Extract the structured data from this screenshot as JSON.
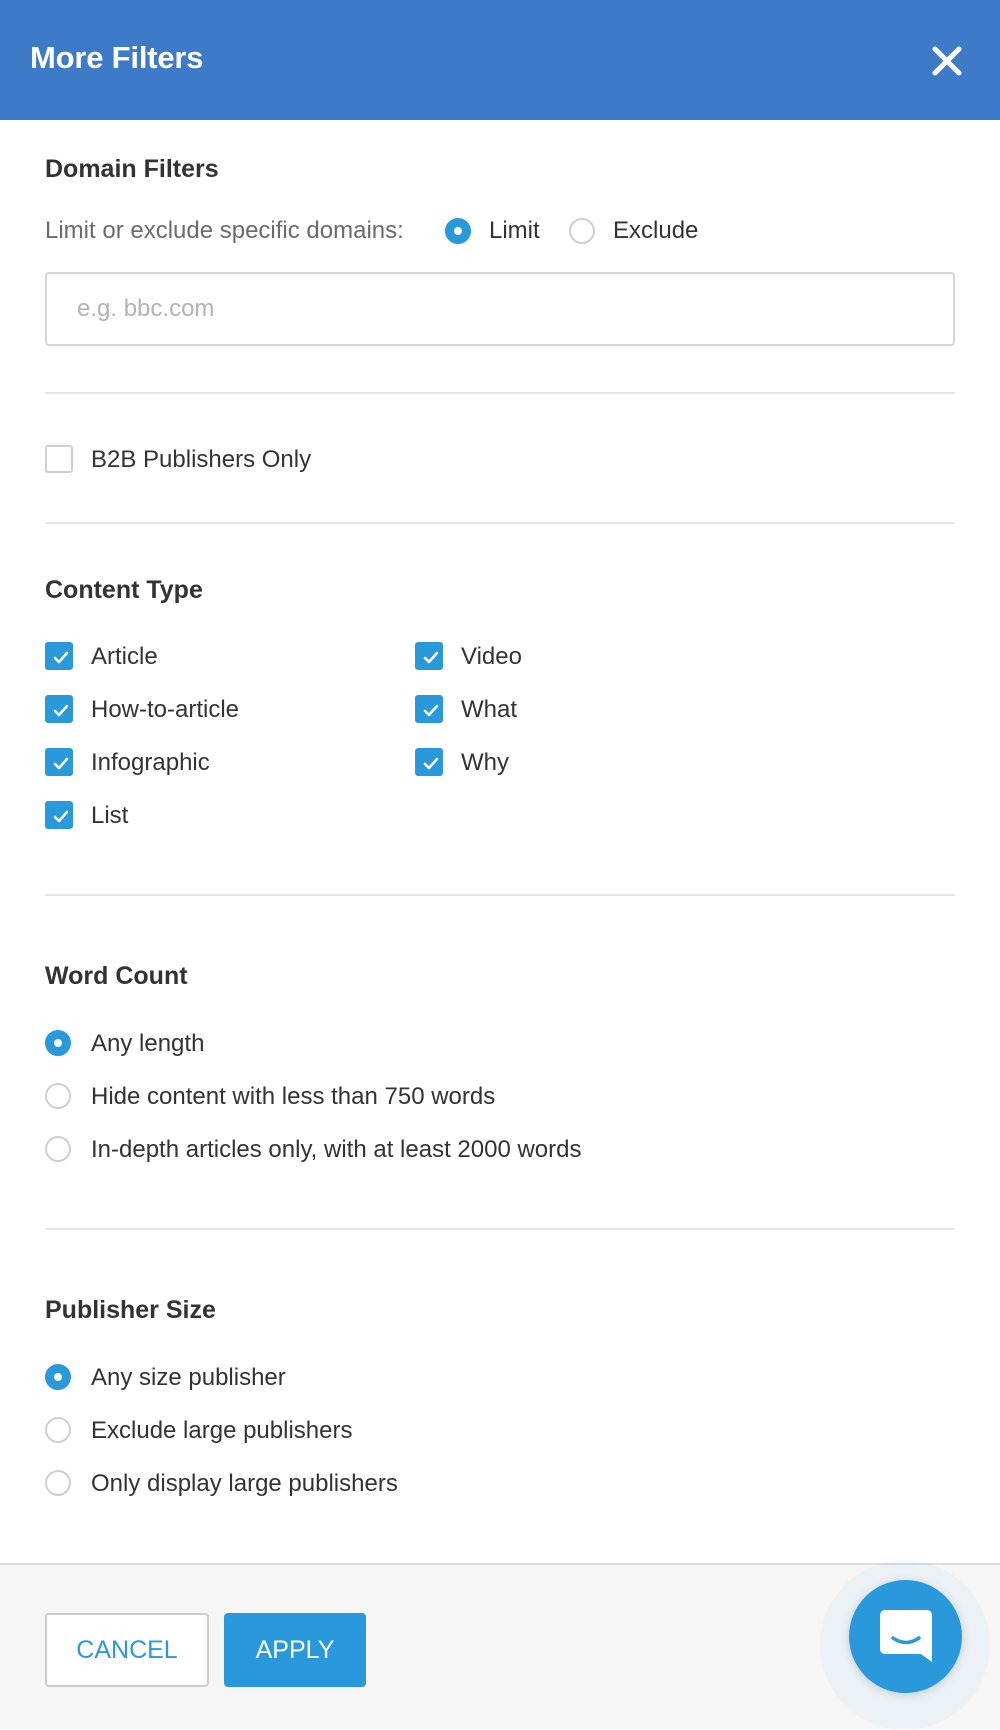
{
  "header": {
    "title": "More Filters",
    "close_icon": "close-icon"
  },
  "domain_filters": {
    "title": "Domain Filters",
    "prompt": "Limit or exclude specific domains:",
    "mode_options": [
      {
        "label": "Limit",
        "selected": true
      },
      {
        "label": "Exclude",
        "selected": false
      }
    ],
    "input_placeholder": "e.g. bbc.com",
    "input_value": ""
  },
  "b2b": {
    "label": "B2B Publishers Only",
    "checked": false
  },
  "content_type": {
    "title": "Content Type",
    "items": [
      {
        "label": "Article",
        "checked": true
      },
      {
        "label": "How-to-article",
        "checked": true
      },
      {
        "label": "Infographic",
        "checked": true
      },
      {
        "label": "List",
        "checked": true
      },
      {
        "label": "Video",
        "checked": true
      },
      {
        "label": "What",
        "checked": true
      },
      {
        "label": "Why",
        "checked": true
      }
    ]
  },
  "word_count": {
    "title": "Word Count",
    "options": [
      {
        "label": "Any length",
        "selected": true
      },
      {
        "label": "Hide content with less than 750 words",
        "selected": false
      },
      {
        "label": "In-depth articles only, with at least 2000 words",
        "selected": false
      }
    ]
  },
  "publisher_size": {
    "title": "Publisher Size",
    "options": [
      {
        "label": "Any size publisher",
        "selected": true
      },
      {
        "label": "Exclude large publishers",
        "selected": false
      },
      {
        "label": "Only display large publishers",
        "selected": false
      }
    ]
  },
  "footer": {
    "cancel_label": "CANCEL",
    "apply_label": "APPLY"
  },
  "chat": {
    "icon": "chat-icon"
  },
  "colors": {
    "header_bg": "#3d7ac8",
    "accent": "#2a99dc",
    "footer_bg": "#f6f6f6"
  }
}
